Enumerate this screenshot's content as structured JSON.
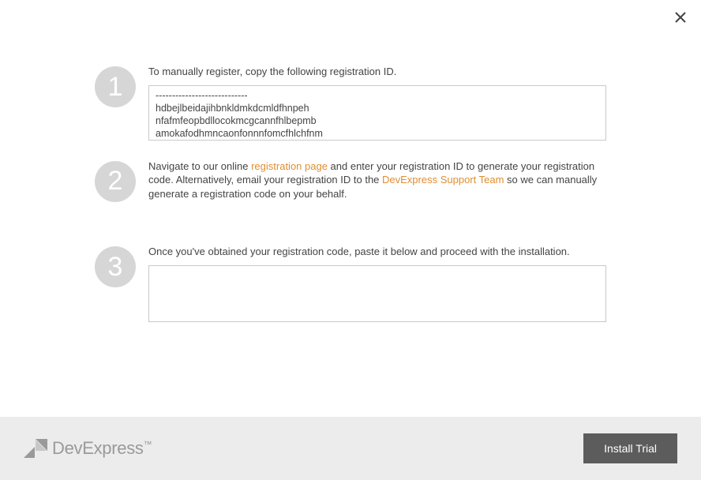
{
  "close_icon": "close",
  "steps": {
    "s1": {
      "num": "1",
      "label": "To manually register, copy the following registration ID.",
      "reg_lines": {
        "l0": "----------------------------",
        "l1": "hdbejlbeidajihbnkldmkdcmldfhnpeh",
        "l2": "nfafmfeopbdllocokmcgcannfhlbepmb",
        "l3": "amokafodhmncaonfonnnfomcfhlchfnm"
      }
    },
    "s2": {
      "num": "2",
      "label_a": "Navigate to our online ",
      "link1": "registration page",
      "label_b": " and enter your registration ID to generate your registration code. Alternatively, email your registration ID to the ",
      "link2": "DevExpress Support Team",
      "label_c": " so we can manually generate a registration code on your behalf."
    },
    "s3": {
      "num": "3",
      "label": "Once you've obtained your registration code, paste it below and proceed with the installation.",
      "code_value": ""
    }
  },
  "footer": {
    "brand": "DevExpress",
    "tm": "™",
    "install_label": "Install Trial"
  }
}
